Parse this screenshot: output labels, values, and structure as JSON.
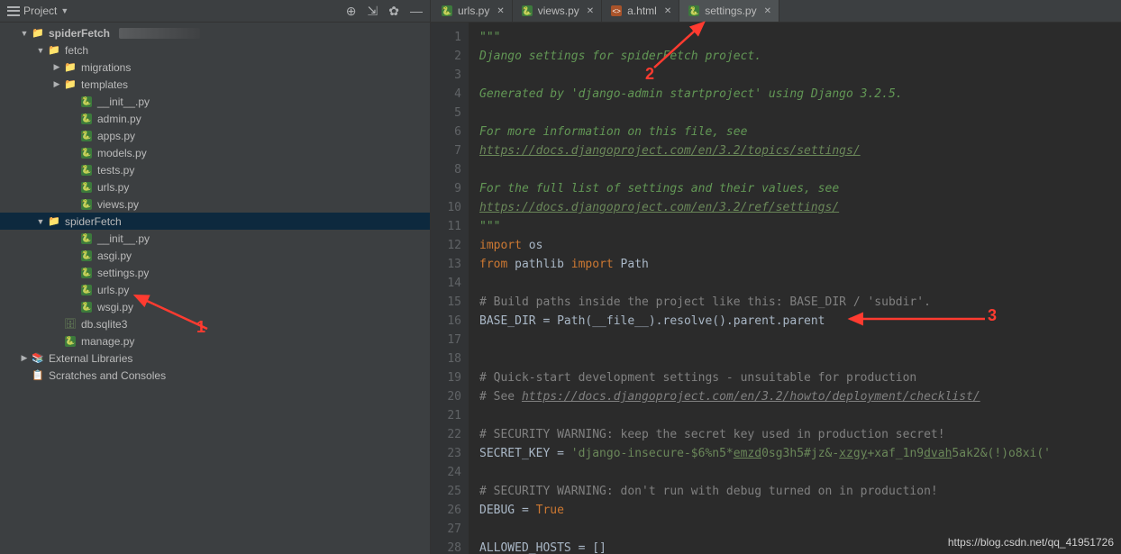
{
  "sidebar": {
    "title": "Project",
    "tree": [
      {
        "depth": 1,
        "chev": "down",
        "icon": "folder",
        "label": "spiderFetch",
        "bold": true
      },
      {
        "depth": 2,
        "chev": "down",
        "icon": "folder",
        "label": "fetch"
      },
      {
        "depth": 3,
        "chev": "right",
        "icon": "folder",
        "label": "migrations"
      },
      {
        "depth": 3,
        "chev": "right",
        "icon": "folder-p",
        "label": "templates"
      },
      {
        "depth": 4,
        "chev": "none",
        "icon": "py",
        "label": "__init__.py"
      },
      {
        "depth": 4,
        "chev": "none",
        "icon": "py",
        "label": "admin.py"
      },
      {
        "depth": 4,
        "chev": "none",
        "icon": "py",
        "label": "apps.py"
      },
      {
        "depth": 4,
        "chev": "none",
        "icon": "py",
        "label": "models.py"
      },
      {
        "depth": 4,
        "chev": "none",
        "icon": "py",
        "label": "tests.py"
      },
      {
        "depth": 4,
        "chev": "none",
        "icon": "py",
        "label": "urls.py"
      },
      {
        "depth": 4,
        "chev": "none",
        "icon": "py",
        "label": "views.py"
      },
      {
        "depth": 2,
        "chev": "down",
        "icon": "folder",
        "label": "spiderFetch",
        "selected": true
      },
      {
        "depth": 4,
        "chev": "none",
        "icon": "py",
        "label": "__init__.py"
      },
      {
        "depth": 4,
        "chev": "none",
        "icon": "py",
        "label": "asgi.py"
      },
      {
        "depth": 4,
        "chev": "none",
        "icon": "py",
        "label": "settings.py"
      },
      {
        "depth": 4,
        "chev": "none",
        "icon": "py",
        "label": "urls.py"
      },
      {
        "depth": 4,
        "chev": "none",
        "icon": "py",
        "label": "wsgi.py"
      },
      {
        "depth": 3,
        "chev": "none",
        "icon": "db",
        "label": "db.sqlite3"
      },
      {
        "depth": 3,
        "chev": "none",
        "icon": "py",
        "label": "manage.py"
      },
      {
        "depth": 1,
        "chev": "right",
        "icon": "lib",
        "label": "External Libraries"
      },
      {
        "depth": 1,
        "chev": "none",
        "icon": "scratch",
        "label": "Scratches and Consoles"
      }
    ]
  },
  "tabs": [
    {
      "label": "urls.py",
      "icon": "py"
    },
    {
      "label": "views.py",
      "icon": "py"
    },
    {
      "label": "a.html",
      "icon": "html"
    },
    {
      "label": "settings.py",
      "icon": "py",
      "active": true
    }
  ],
  "code": {
    "lines": [
      {
        "n": 1,
        "html": "<span class='c-doc'>\"\"\"</span>"
      },
      {
        "n": 2,
        "html": "<span class='c-doc'>Django settings for spiderFetch project.</span>"
      },
      {
        "n": 3,
        "html": ""
      },
      {
        "n": 4,
        "html": "<span class='c-doc'>Generated by 'django-admin startproject' using Django 3.2.5.</span>"
      },
      {
        "n": 5,
        "html": ""
      },
      {
        "n": 6,
        "html": "<span class='c-doc'>For more information on this file, see</span>"
      },
      {
        "n": 7,
        "html": "<span class='c-link'>https://docs.djangoproject.com/en/3.2/topics/settings/</span>"
      },
      {
        "n": 8,
        "html": ""
      },
      {
        "n": 9,
        "html": "<span class='c-doc'>For the full list of settings and their values, see</span>"
      },
      {
        "n": 10,
        "html": "<span class='c-link'>https://docs.djangoproject.com/en/3.2/ref/settings/</span>"
      },
      {
        "n": 11,
        "html": "<span class='c-doc'>\"\"\"</span>"
      },
      {
        "n": 12,
        "html": "<span class='c-kw'>import</span> os"
      },
      {
        "n": 13,
        "html": "<span class='c-kw'>from</span> pathlib <span class='c-kw'>import</span> Path"
      },
      {
        "n": 14,
        "html": ""
      },
      {
        "n": 15,
        "html": "<span class='c-com'># Build paths inside the project like this: BASE_DIR / 'subdir'.</span>"
      },
      {
        "n": 16,
        "html": "BASE_DIR = Path(__file__).resolve().parent.parent"
      },
      {
        "n": 17,
        "html": ""
      },
      {
        "n": 18,
        "html": ""
      },
      {
        "n": 19,
        "html": "<span class='c-com'># Quick-start development settings - unsuitable for production</span>"
      },
      {
        "n": 20,
        "html": "<span class='c-com'># See </span><span class='c-link' style='color:#808080'>https://docs.djangoproject.com/en/3.2/howto/deployment/checklist/</span>"
      },
      {
        "n": 21,
        "html": ""
      },
      {
        "n": 22,
        "html": "<span class='c-com'># SECURITY WARNING: keep the secret key used in production secret!</span>"
      },
      {
        "n": 23,
        "html": "SECRET_KEY = <span class='c-str'>'django-insecure-$6%n5*<u>emzd</u>0sg3h5#jz&amp;-<u>xzgy</u>+xaf_1n9<u>dvah</u>5ak2&amp;(!)o8xi('</span>"
      },
      {
        "n": 24,
        "html": ""
      },
      {
        "n": 25,
        "html": "<span class='c-com'># SECURITY WARNING: don't run with debug turned on in production!</span>"
      },
      {
        "n": 26,
        "html": "DEBUG = <span class='c-kwv'>True</span>"
      },
      {
        "n": 27,
        "html": ""
      },
      {
        "n": 28,
        "html": "ALLOWED_HOSTS = []"
      }
    ]
  },
  "annotations": {
    "a1": "1",
    "a2": "2",
    "a3": "3"
  },
  "watermark": "https://blog.csdn.net/qq_41951726"
}
